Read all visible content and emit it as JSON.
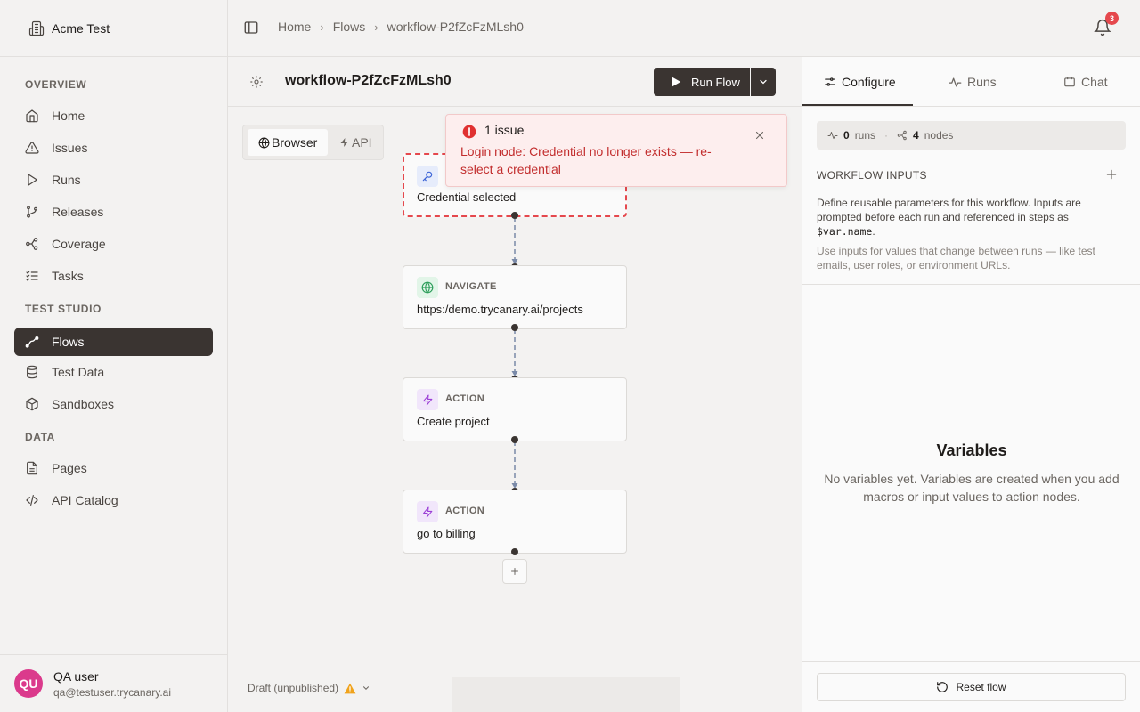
{
  "workspace": {
    "name": "Acme Test",
    "icon": "building-icon"
  },
  "sidebar": {
    "sections": [
      {
        "title": "OVERVIEW",
        "items": [
          {
            "label": "Home",
            "icon": "home-icon"
          },
          {
            "label": "Issues",
            "icon": "alert-triangle-icon"
          },
          {
            "label": "Runs",
            "icon": "play-icon"
          },
          {
            "label": "Releases",
            "icon": "git-branch-icon"
          },
          {
            "label": "Coverage",
            "icon": "network-icon"
          },
          {
            "label": "Tasks",
            "icon": "list-checks-icon"
          }
        ]
      },
      {
        "title": "TEST STUDIO",
        "items": [
          {
            "label": "Flows",
            "icon": "flow-icon",
            "active": true
          },
          {
            "label": "Test Data",
            "icon": "database-icon"
          },
          {
            "label": "Sandboxes",
            "icon": "box-icon"
          }
        ]
      },
      {
        "title": "DATA",
        "items": [
          {
            "label": "Pages",
            "icon": "file-icon"
          },
          {
            "label": "API Catalog",
            "icon": "code-icon"
          }
        ]
      }
    ]
  },
  "user": {
    "initials": "QU",
    "name": "QA user",
    "email": "qa@testuser.trycanary.ai"
  },
  "topbar": {
    "breadcrumbs": [
      "Home",
      "Flows",
      "workflow-P2fZcFzMLsh0"
    ],
    "notifications_count": "3"
  },
  "workflow": {
    "title": "workflow-P2fZcFzMLsh0",
    "run_label": "Run Flow",
    "modes": [
      "Browser",
      "API"
    ],
    "draft_label": "Draft (unpublished)"
  },
  "nodes": [
    {
      "type": "",
      "text": "Credential selected",
      "icon": "key-icon",
      "error": true
    },
    {
      "type": "NAVIGATE",
      "text": "https:/demo.trycanary.ai/projects",
      "icon": "globe-icon"
    },
    {
      "type": "ACTION",
      "text": "Create project",
      "icon": "zap-icon"
    },
    {
      "type": "ACTION",
      "text": "go to billing",
      "icon": "zap-icon"
    }
  ],
  "toast": {
    "title": "1 issue",
    "message": "Login node: Credential no longer exists — re-select a credential"
  },
  "panel": {
    "tabs": [
      "Configure",
      "Runs",
      "Chat"
    ],
    "active_tab": "Configure",
    "stats": {
      "runs_count": "0",
      "runs_label": "runs",
      "nodes_count": "4",
      "nodes_label": "nodes"
    },
    "inputs_title": "WORKFLOW INPUTS",
    "inputs_desc_before": "Define reusable parameters for this workflow. Inputs are prompted before each run and referenced in steps as ",
    "inputs_desc_code": "$var.name",
    "inputs_desc_after": ".",
    "inputs_hint": "Use inputs for values that change between runs — like test emails, user roles, or environment URLs.",
    "variables_title": "Variables",
    "variables_empty": "No variables yet. Variables are created when you add macros or input values to action nodes.",
    "reset_label": "Reset flow"
  },
  "colors": {
    "accent_dark": "#3a3431",
    "error": "#e5484d",
    "avatar": "#db3a8c"
  }
}
